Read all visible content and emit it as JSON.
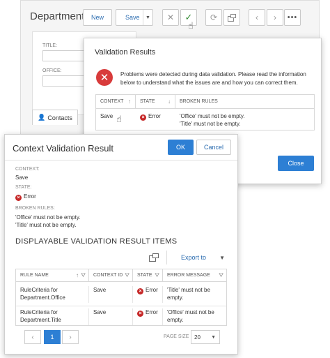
{
  "department": {
    "title": "Department",
    "toolbar": {
      "new_label": "New",
      "save_label": "Save",
      "more_label": "•••"
    },
    "form": {
      "title_label": "TITLE:",
      "office_label": "OFFICE:"
    },
    "tab_contacts": "Contacts"
  },
  "validation_results": {
    "title": "Validation Results",
    "message": "Problems were detected during data validation. Please read the information below to understand what the issues are and how you can correct them.",
    "columns": [
      "CONTEXT",
      "STATE",
      "BROKEN RULES"
    ],
    "row": {
      "context": "Save",
      "state": "Error",
      "broken_rules": [
        "'Office' must not be empty.",
        "'Title' must not be empty."
      ]
    },
    "close_label": "Close"
  },
  "context_validation": {
    "title": "Context Validation Result",
    "ok_label": "OK",
    "cancel_label": "Cancel",
    "context_label": "CONTEXT:",
    "context_value": "Save",
    "state_label": "STATE:",
    "state_value": "Error",
    "broken_rules_label": "BROKEN RULES:",
    "broken_rules": [
      "'Office' must not be empty.",
      "'Title' must not be empty."
    ],
    "items_title": "DISPLAYABLE VALIDATION RESULT ITEMS",
    "export_label": "Export to",
    "grid": {
      "columns": [
        "RULE NAME",
        "CONTEXT ID",
        "STATE",
        "ERROR MESSAGE"
      ],
      "rows": [
        {
          "rule_name_1": "RuleCriteria for",
          "rule_name_2": "Department.Office",
          "context_id": "Save",
          "state": "Error",
          "message_1": "'Title' must not be",
          "message_2": "empty."
        },
        {
          "rule_name_1": "RuleCriteria for",
          "rule_name_2": "Department.Title",
          "context_id": "Save",
          "state": "Error",
          "message_1": "'Office' must not be",
          "message_2": "empty."
        }
      ]
    },
    "pager": {
      "current_page": "1",
      "page_size_label": "PAGE SIZE",
      "page_size_value": "20"
    }
  },
  "colors": {
    "accent": "#2d7fd4",
    "error": "#c62828",
    "success": "#2f8a2f"
  }
}
